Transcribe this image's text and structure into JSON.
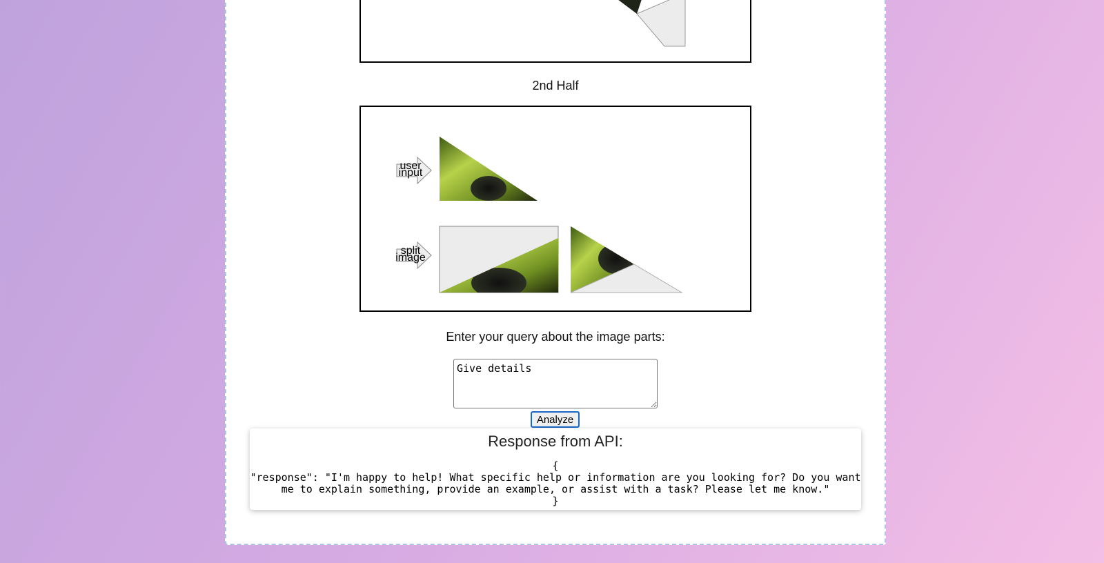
{
  "top_section": {},
  "second_half": {
    "title": "2nd Half"
  },
  "diagram": {
    "arrow_1_label_line1": "user",
    "arrow_1_label_line2": "input",
    "arrow_2_label_line1": "split",
    "arrow_2_label_line2": "image"
  },
  "query": {
    "label": "Enter your query about the image parts:",
    "value": "Give details"
  },
  "analyze_button": {
    "label": "Analyze"
  },
  "response": {
    "title": "Response from API:",
    "body": "{\n\"response\": \"I'm happy to help! What specific help or information are you looking for? Do you want me to explain something, provide an example, or assist with a task? Please let me know.\"\n}"
  }
}
